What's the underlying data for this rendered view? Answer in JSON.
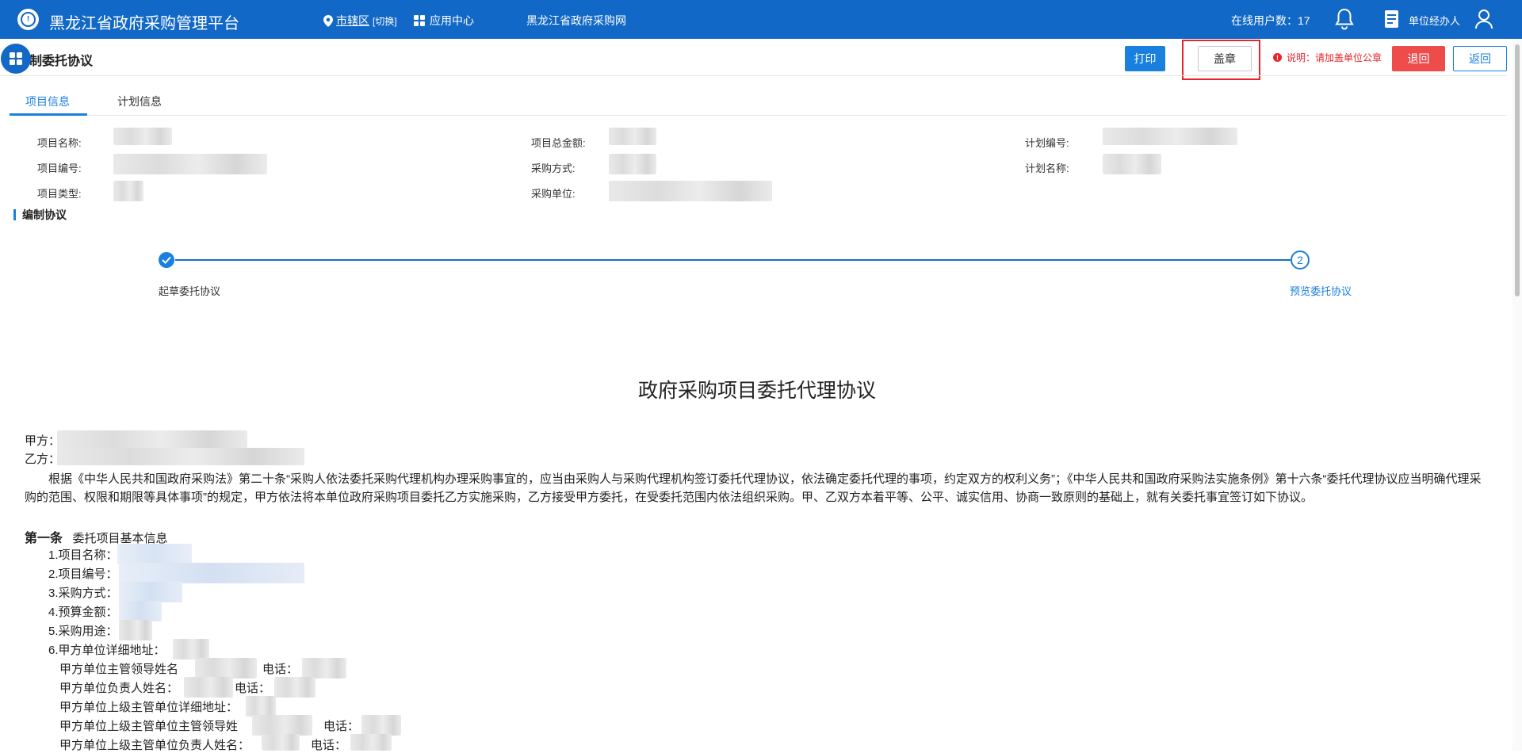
{
  "topbar": {
    "app_title": "黑龙江省政府采购管理平台",
    "region_name": "市辖区",
    "region_switch": "[切换]",
    "app_center": "应用中心",
    "portal_link": "黑龙江省政府采购网",
    "online_users": "在线用户数：17",
    "user_role": "单位经办人",
    "icons": [
      "location-pin-icon",
      "grid-icon",
      "bell-icon",
      "document-icon",
      "user-icon"
    ]
  },
  "page": {
    "title": "编制委托协议",
    "title_visible": "制委托协议"
  },
  "toolbar": {
    "print_label": "打印",
    "stamp_label": "盖章",
    "note_label": "说明：请加盖单位公章",
    "reject_label": "退回",
    "back_label": "返回"
  },
  "tabs": [
    {
      "label": "项目信息",
      "active": true
    },
    {
      "label": "计划信息",
      "active": false
    }
  ],
  "info": {
    "project_name_label": "项目名称:",
    "project_total_label": "项目总金额:",
    "plan_no_label": "计划编号:",
    "project_no_label": "项目编号:",
    "purchase_method_label": "采购方式:",
    "plan_name_label": "计划名称:",
    "project_type_label": "项目类型:",
    "purchase_unit_label": "采购单位:"
  },
  "section": {
    "title": "编制协议"
  },
  "steps": [
    {
      "label": "起草委托协议",
      "state": "done"
    },
    {
      "number": "2",
      "label": "预览委托协议",
      "state": "current"
    }
  ],
  "document": {
    "title": "政府采购项目委托代理协议",
    "party_a": "甲方：",
    "party_b": "乙方：",
    "intro": "根据《中华人民共和国政府采购法》第二十条“采购人依法委托采购代理机构办理采购事宜的，应当由采购人与采购代理机构签订委托代理协议，依法确定委托代理的事项，约定双方的权利义务”；《中华人民共和国政府采购法实施条例》第十六条“委托代理协议应当明确代理采购的范围、权限和期限等具体事项”的规定，甲方依法将本单位政府采购项目委托乙方实施采购，乙方接受甲方委托，在受委托范围内依法组织采购。甲、乙双方本着平等、公平、诚实信用、协商一致原则的基础上，就有关委托事宜签订如下协议。",
    "article1_num": "第一条",
    "article1_title": "委托项目基本信息",
    "items": [
      "1.项目名称：",
      "2.项目编号：",
      "3.采购方式：",
      "4.预算金额：",
      "5.采购用途：",
      "6.甲方单位详细地址："
    ],
    "leader_name": "甲方单位主管领导姓名",
    "phone1": "电话：",
    "person_name": "甲方单位负责人姓名：",
    "phone2": "电话：",
    "superior_address": "甲方单位上级主管单位详细地址：",
    "superior_leader": "甲方单位上级主管单位主管领导姓",
    "phone3": "电话：",
    "superior_person": "甲方单位上级主管单位负责人姓名：",
    "phone4": "电话："
  },
  "colors": {
    "topbar": "#1268c6",
    "accent": "#1a80e0",
    "danger": "#ee4b4b",
    "highlight_box": "#e8232b"
  }
}
